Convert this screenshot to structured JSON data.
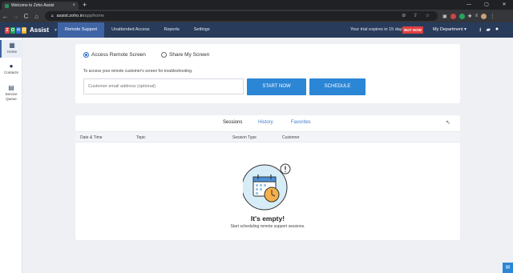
{
  "browser": {
    "tab_title": "Welcome to Zoho Assist",
    "tab_close": "×",
    "new_tab": "+",
    "window_controls": [
      "—",
      "▢",
      "✕"
    ],
    "url_host": "assist.zoho.in",
    "url_path": "/app/home",
    "back": "←",
    "forward": "→",
    "reload": "C",
    "home": "⌂"
  },
  "header": {
    "brand": "Assist",
    "tabs": [
      {
        "label": "Remote Support",
        "active": true
      },
      {
        "label": "Unattended Access",
        "active": false
      },
      {
        "label": "Reports",
        "active": false
      },
      {
        "label": "Settings",
        "active": false
      }
    ],
    "trial_text": "Your trial expires in 15 days.",
    "buy_label": "BUY NOW",
    "department": "My Department ▾"
  },
  "sidebar": {
    "items": [
      {
        "label": "Home",
        "icon": "building-icon"
      },
      {
        "label": "Contacts",
        "icon": "person-icon"
      },
      {
        "label": "Service Queue",
        "icon": "queue-icon"
      }
    ]
  },
  "session_start": {
    "options": [
      "Access Remote Screen",
      "Share My Screen"
    ],
    "selected": "Access Remote Screen",
    "hint": "To access your remote customer's screen for troubleshooting.",
    "email_placeholder": "Customer email address (optional)",
    "start_label": "START NOW",
    "schedule_label": "SCHEDULE"
  },
  "sessions": {
    "tabs": [
      {
        "label": "Sessions",
        "active": true
      },
      {
        "label": "History",
        "active": false
      },
      {
        "label": "Favorites",
        "active": false
      }
    ],
    "columns": [
      "Date & Time",
      "Topic",
      "Session Type",
      "Customer"
    ],
    "empty_title": "It's empty!",
    "empty_subtitle": "Start scheduling remote support sessions."
  },
  "colors": {
    "header_bg": "#283b5b",
    "active_tab": "#3f64a6",
    "primary_button": "#2b86d6",
    "buy_now": "#e04040"
  }
}
